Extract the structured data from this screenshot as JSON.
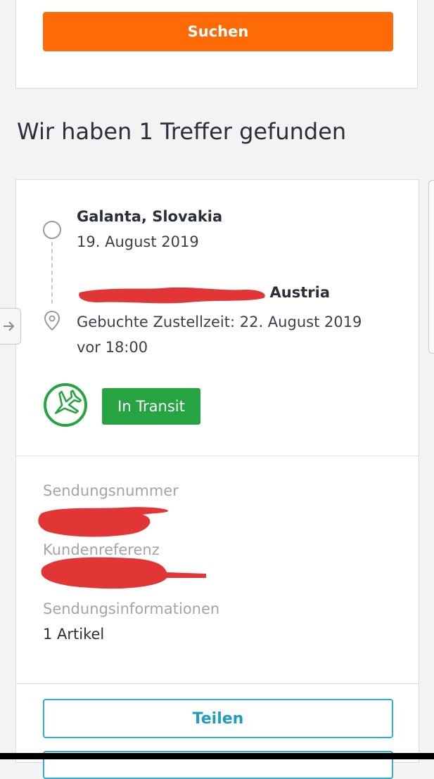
{
  "search": {
    "button_label": "Suchen"
  },
  "results": {
    "title": "Wir haben 1 Treffer gefunden"
  },
  "shipment": {
    "origin": {
      "city": "Galanta, Slovakia",
      "date": "19. August 2019"
    },
    "destination": {
      "city_visible_part": "Austria",
      "delivery_time": "Gebuchte Zustellzeit: 22. August 2019 vor 18:00"
    },
    "status": {
      "label": "In Transit",
      "icon": "airplane-icon",
      "color": "#25a441"
    },
    "info": {
      "tracking_number_label": "Sendungsnummer",
      "customer_reference_label": "Kundenreferenz",
      "shipment_info_label": "Sendungsinformationen",
      "shipment_info_value": "1 Artikel"
    },
    "share_button_label": "Teilen"
  },
  "colors": {
    "accent_orange": "#fe6a06",
    "status_green": "#25a441",
    "share_blue": "#2ab1d4",
    "redaction_red": "#e23535"
  }
}
